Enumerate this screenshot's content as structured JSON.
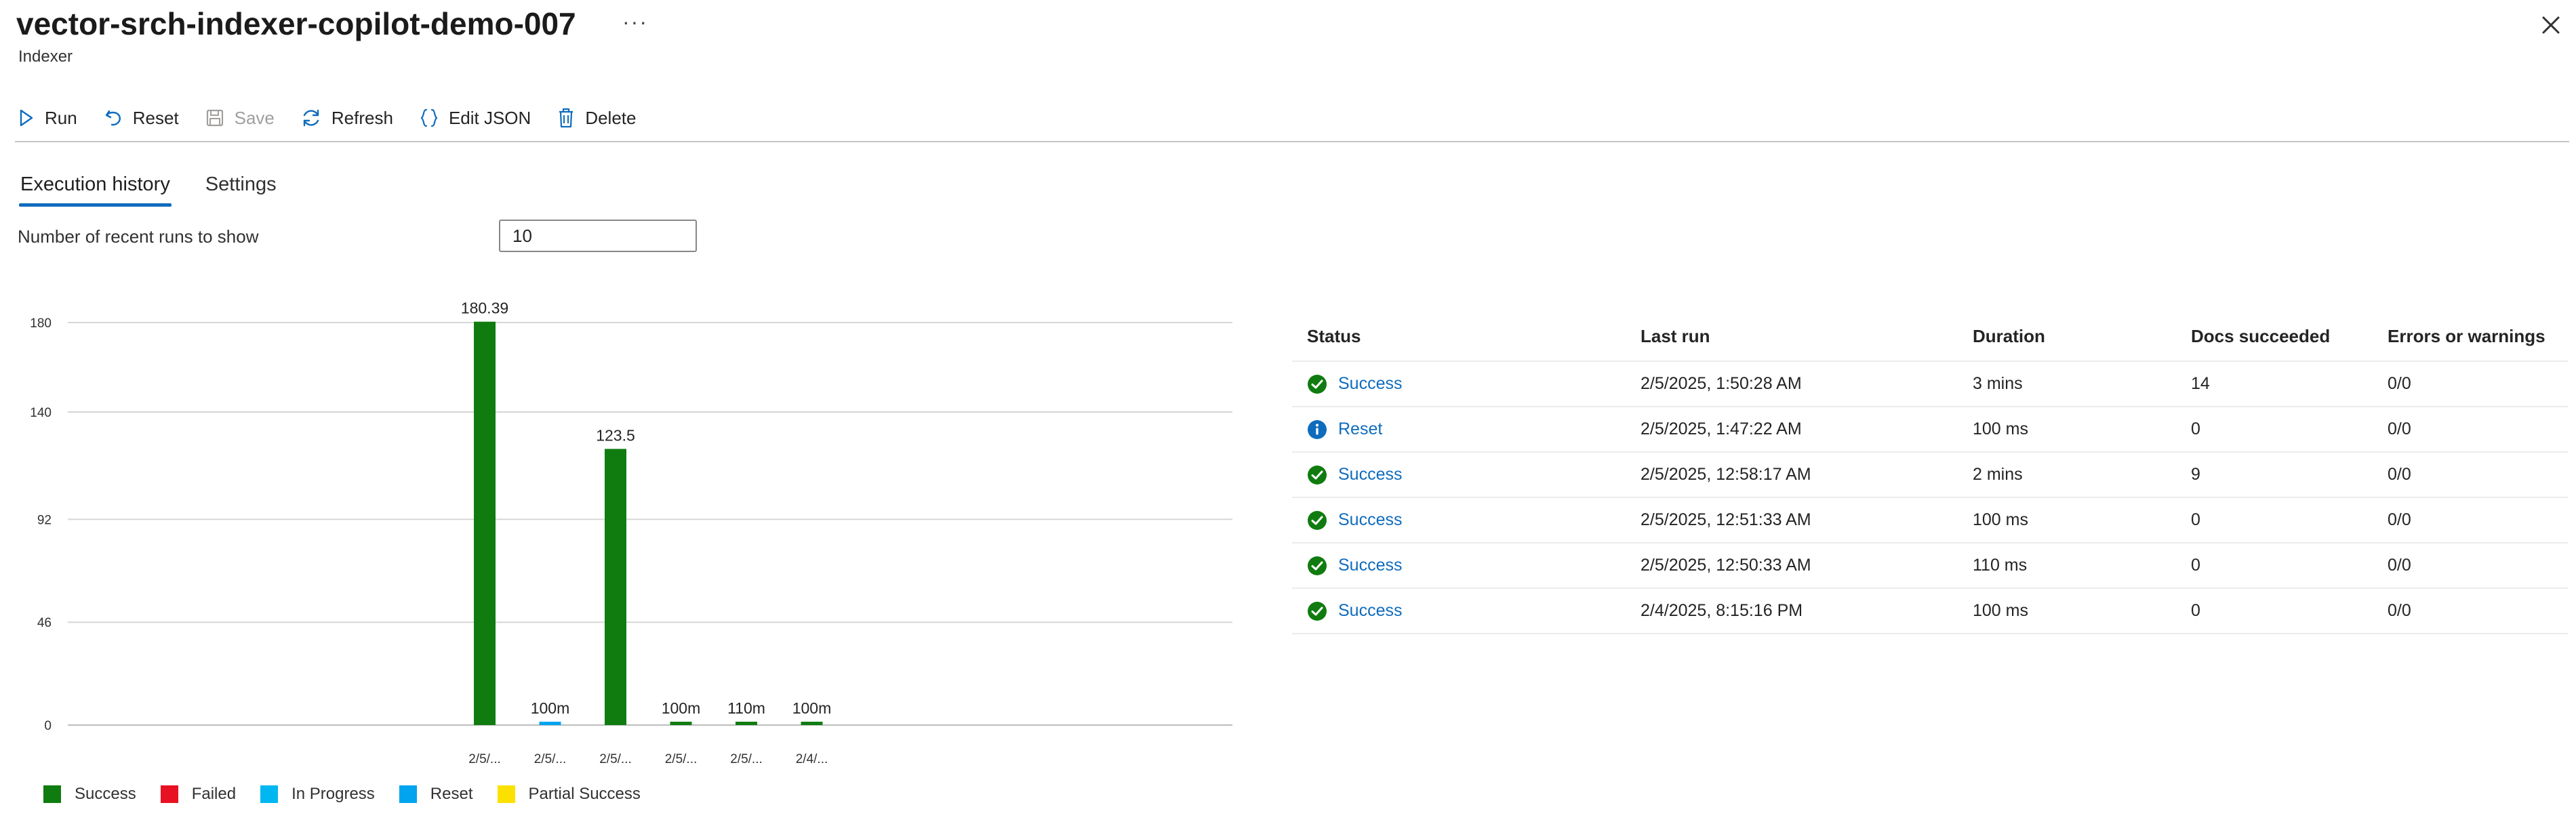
{
  "header": {
    "title": "vector-srch-indexer-copilot-demo-007",
    "more_label": "···",
    "subtitle": "Indexer",
    "close_icon": "close-icon"
  },
  "toolbar": {
    "run": "Run",
    "reset": "Reset",
    "save": "Save",
    "refresh": "Refresh",
    "edit_json": "Edit JSON",
    "delete": "Delete"
  },
  "tabs": {
    "execution_history": "Execution history",
    "settings": "Settings",
    "active": "Execution history"
  },
  "runs_filter": {
    "label": "Number of recent runs to show",
    "value": "10"
  },
  "colors": {
    "success": "#107c10",
    "failed": "#e81123",
    "in_progress": "#00b7f1",
    "reset": "#00a4ef",
    "partial_success": "#fce100",
    "link": "#0f6cbd"
  },
  "chart_data": {
    "type": "bar",
    "yticks": [
      0,
      46,
      92,
      140,
      180
    ],
    "ylim": [
      0,
      180
    ],
    "grid": true,
    "categories": [
      "2/5/...",
      "2/5/...",
      "2/5/...",
      "2/5/...",
      "2/5/...",
      "2/4/..."
    ],
    "values": [
      180.39,
      1.5,
      123.5,
      1.5,
      1.5,
      1.5
    ],
    "data_labels": [
      "180.39",
      "100m",
      "123.5",
      "100m",
      "110m",
      "100m"
    ],
    "statuses": [
      "success",
      "reset",
      "success",
      "success",
      "success",
      "success"
    ],
    "legend": [
      {
        "key": "success",
        "label": "Success"
      },
      {
        "key": "failed",
        "label": "Failed"
      },
      {
        "key": "in_progress",
        "label": "In Progress"
      },
      {
        "key": "reset",
        "label": "Reset"
      },
      {
        "key": "partial_success",
        "label": "Partial Success"
      }
    ],
    "legend_position": "bottom-left"
  },
  "history": {
    "columns": [
      "Status",
      "Last run",
      "Duration",
      "Docs succeeded",
      "Errors or warnings"
    ],
    "rows": [
      {
        "status": "Success",
        "status_type": "success",
        "last_run": "2/5/2025, 1:50:28 AM",
        "duration": "3 mins",
        "docs": "14",
        "errors": "0/0"
      },
      {
        "status": "Reset",
        "status_type": "info",
        "last_run": "2/5/2025, 1:47:22 AM",
        "duration": "100 ms",
        "docs": "0",
        "errors": "0/0"
      },
      {
        "status": "Success",
        "status_type": "success",
        "last_run": "2/5/2025, 12:58:17 AM",
        "duration": "2 mins",
        "docs": "9",
        "errors": "0/0"
      },
      {
        "status": "Success",
        "status_type": "success",
        "last_run": "2/5/2025, 12:51:33 AM",
        "duration": "100 ms",
        "docs": "0",
        "errors": "0/0"
      },
      {
        "status": "Success",
        "status_type": "success",
        "last_run": "2/5/2025, 12:50:33 AM",
        "duration": "110 ms",
        "docs": "0",
        "errors": "0/0"
      },
      {
        "status": "Success",
        "status_type": "success",
        "last_run": "2/4/2025, 8:15:16 PM",
        "duration": "100 ms",
        "docs": "0",
        "errors": "0/0"
      }
    ]
  }
}
